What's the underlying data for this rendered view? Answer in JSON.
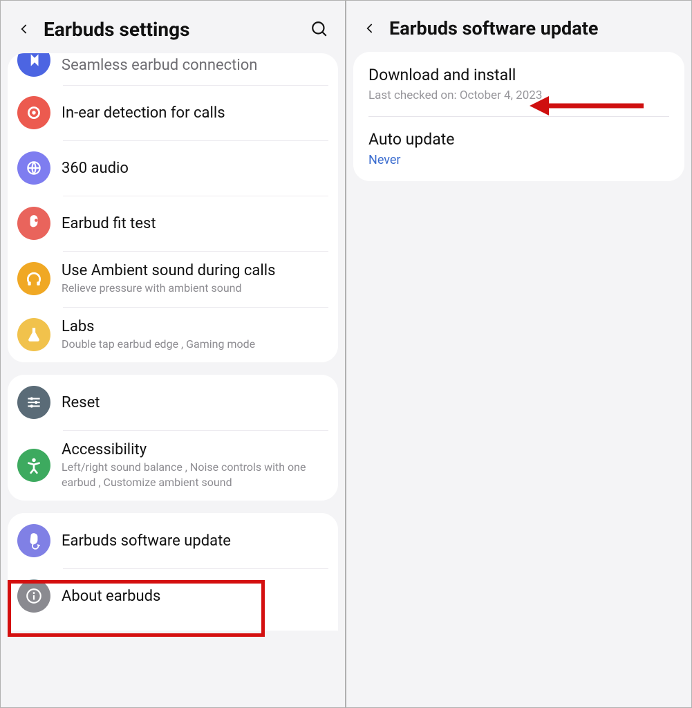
{
  "left": {
    "title": "Earbuds settings",
    "items": [
      {
        "title": "Seamless earbud connection"
      },
      {
        "title": "In-ear detection for calls"
      },
      {
        "title": "360 audio"
      },
      {
        "title": "Earbud fit test"
      },
      {
        "title": "Use Ambient sound during calls",
        "sub": "Relieve pressure with ambient sound"
      },
      {
        "title": "Labs",
        "sub": "Double tap earbud edge , Gaming mode"
      }
    ],
    "group2": [
      {
        "title": "Reset"
      },
      {
        "title": "Accessibility",
        "sub": "Left/right sound balance , Noise controls with one earbud , Customize ambient sound"
      }
    ],
    "group3": [
      {
        "title": "Earbuds software update"
      },
      {
        "title": "About earbuds"
      }
    ]
  },
  "right": {
    "title": "Earbuds software update",
    "items": [
      {
        "title": "Download and install",
        "sub": "Last checked on: October 4, 2023"
      },
      {
        "title": "Auto update",
        "link": "Never"
      }
    ]
  }
}
